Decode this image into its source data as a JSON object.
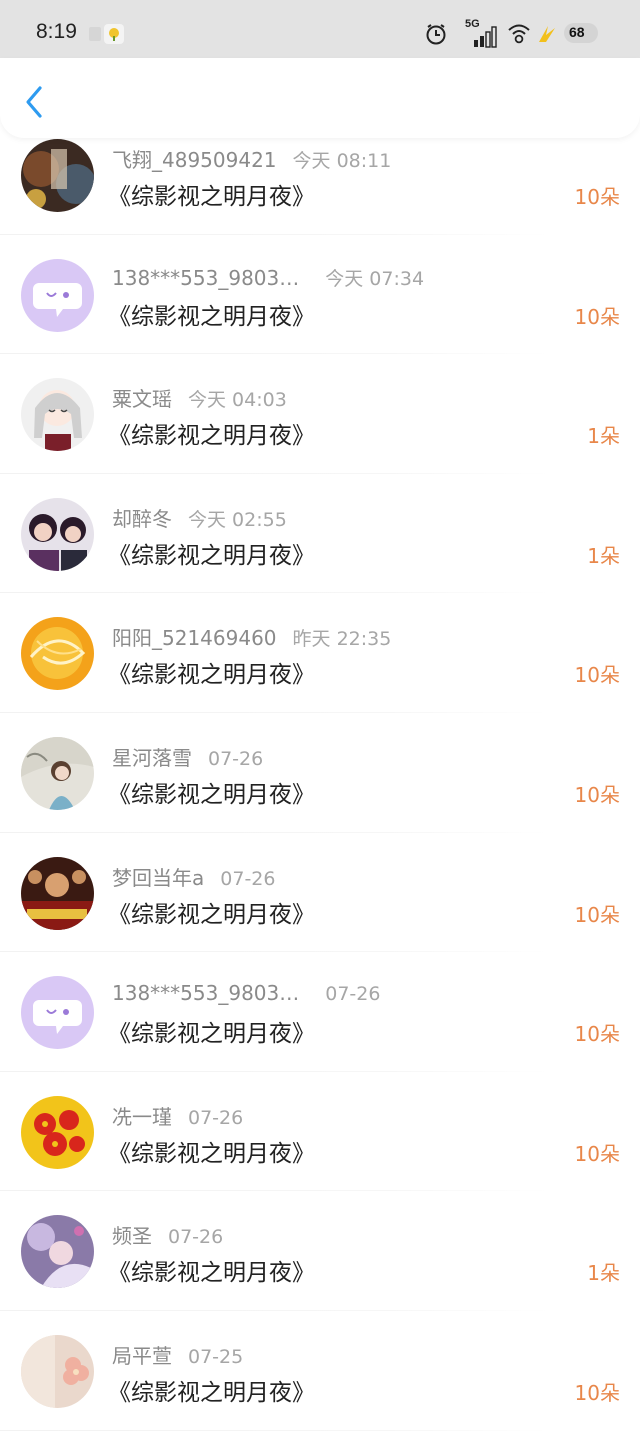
{
  "status_bar": {
    "time": "8:19",
    "network": "5G",
    "battery": "68"
  },
  "header": {
    "back_icon": "chevron-left-icon"
  },
  "colors": {
    "accent_blue": "#2e9bf0",
    "count_orange": "#e8874a",
    "name_grey": "#8a8a8a"
  },
  "records": [
    {
      "name": "飞翔_489509421",
      "time": "今天 08:11",
      "title": "《综影视之明月夜》",
      "count": "10朵",
      "avatar": "poster"
    },
    {
      "name": "138***553_9803…",
      "time": "今天 07:34",
      "title": "《综影视之明月夜》",
      "count": "10朵",
      "avatar": "default-chat"
    },
    {
      "name": "粟文瑶",
      "time": "今天 04:03",
      "title": "《综影视之明月夜》",
      "count": "1朵",
      "avatar": "anime-girl"
    },
    {
      "name": "却醉冬",
      "time": "今天 02:55",
      "title": "《综影视之明月夜》",
      "count": "1朵",
      "avatar": "photo-couple"
    },
    {
      "name": "阳阳_521469460",
      "time": "昨天 22:35",
      "title": "《综影视之明月夜》",
      "count": "10朵",
      "avatar": "orange-swirl"
    },
    {
      "name": "星河落雪",
      "time": "07-26",
      "title": "《综影视之明月夜》",
      "count": "10朵",
      "avatar": "portrait"
    },
    {
      "name": "梦回当年a",
      "time": "07-26",
      "title": "《综影视之明月夜》",
      "count": "10朵",
      "avatar": "poster-crowd"
    },
    {
      "name": "138***553_9803…",
      "time": "07-26",
      "title": "《综影视之明月夜》",
      "count": "10朵",
      "avatar": "default-chat"
    },
    {
      "name": "冼一瑾",
      "time": "07-26",
      "title": "《综影视之明月夜》",
      "count": "10朵",
      "avatar": "red-flower"
    },
    {
      "name": "频圣",
      "time": "07-26",
      "title": "《综影视之明月夜》",
      "count": "1朵",
      "avatar": "fantasy"
    },
    {
      "name": "局平萱",
      "time": "07-25",
      "title": "《综影视之明月夜》",
      "count": "10朵",
      "avatar": "pink-flower"
    }
  ]
}
